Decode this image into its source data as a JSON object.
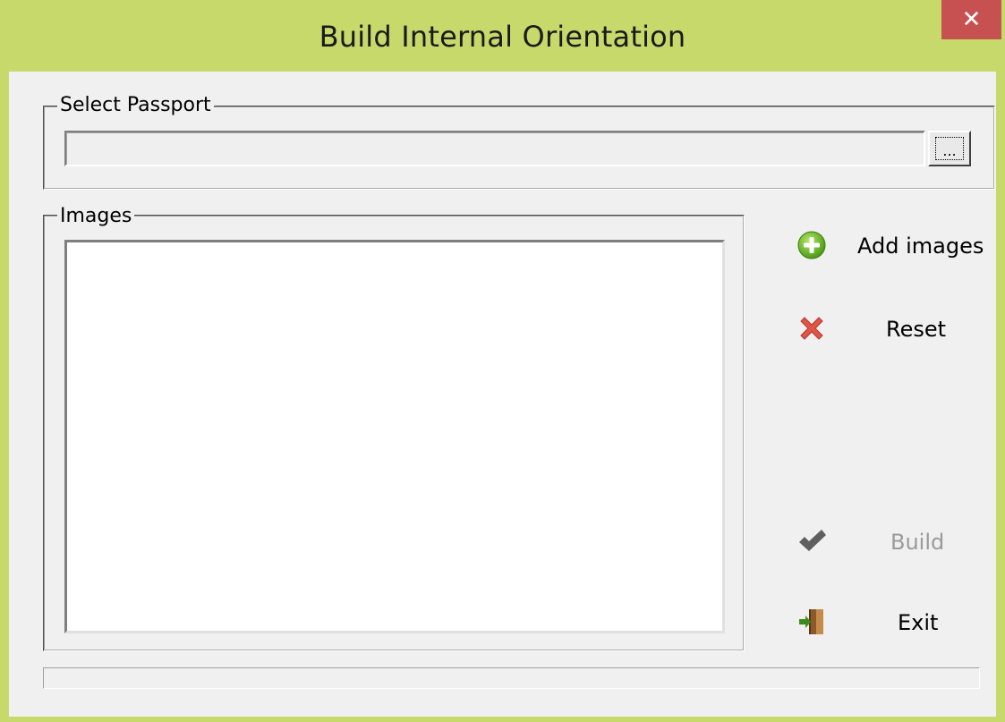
{
  "window": {
    "title": "Build Internal Orientation",
    "close_glyph": "✕"
  },
  "passport": {
    "group_label": "Select Passport",
    "path_value": "",
    "browse_label": "..."
  },
  "images": {
    "group_label": "Images",
    "items": []
  },
  "actions": {
    "add_images": {
      "label": "Add images",
      "icon": "add-circle-icon",
      "color": "#6cbf2a",
      "enabled": true
    },
    "reset": {
      "label": "Reset",
      "icon": "red-x-icon",
      "color": "#e05545",
      "enabled": true
    },
    "build": {
      "label": "Build",
      "icon": "checkmark-icon",
      "color": "#606060",
      "enabled": false
    },
    "exit": {
      "label": "Exit",
      "icon": "exit-door-icon",
      "color": "#8b5a2b",
      "enabled": true
    }
  },
  "status": {
    "text": ""
  },
  "colors": {
    "frame": "#c7d96b",
    "client": "#f0f0f0",
    "close_button": "#c75050"
  }
}
